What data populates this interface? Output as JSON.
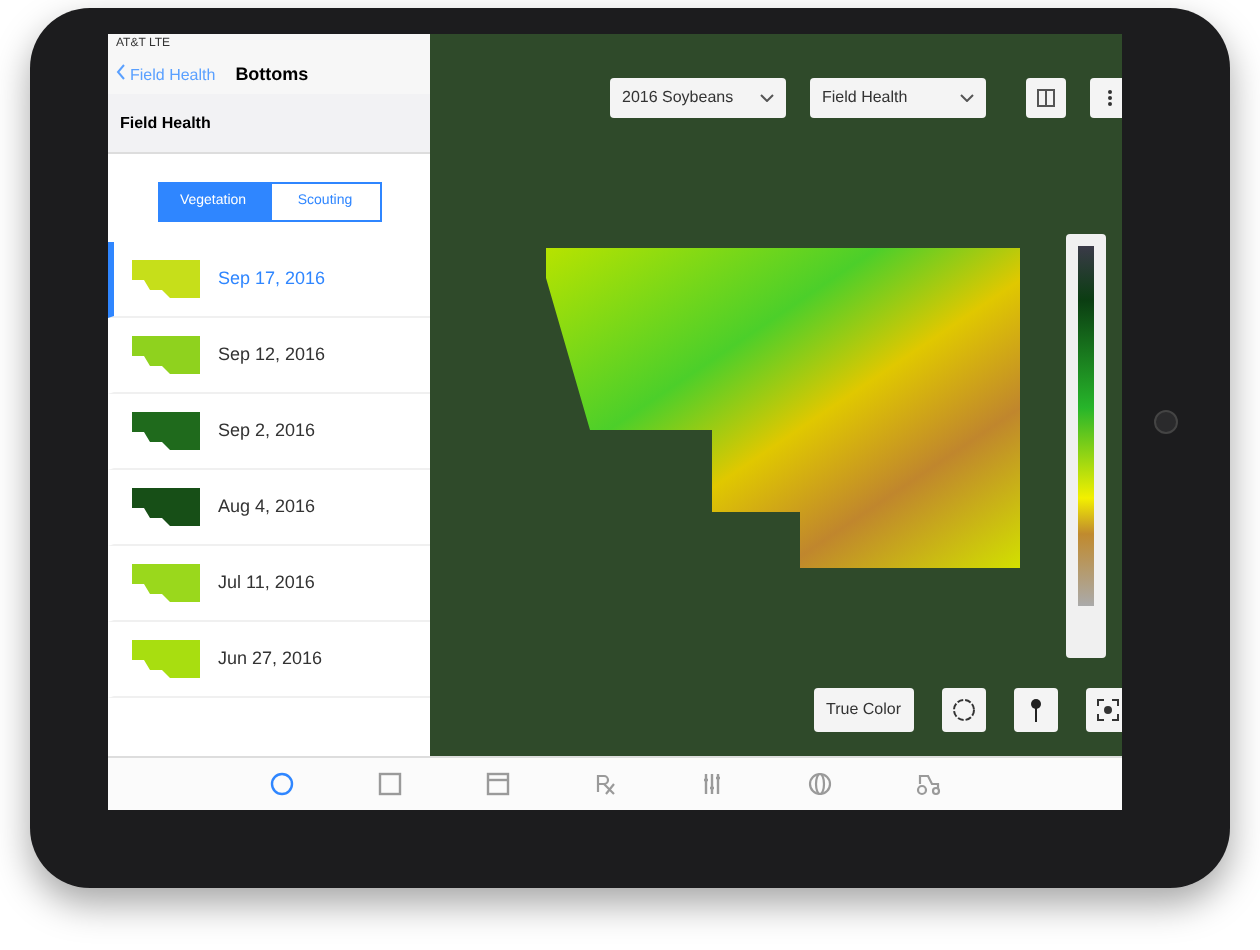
{
  "status_bar": {
    "carrier": "AT&T  LTE"
  },
  "nav": {
    "back": "Field Health",
    "title": "Bottoms"
  },
  "section_title": "Field Health",
  "segments": [
    {
      "label": "Vegetation",
      "selected": true
    },
    {
      "label": "Scouting",
      "selected": false
    }
  ],
  "images": [
    {
      "date": "Sep 17, 2016",
      "selected": true,
      "color": "#c6df1a"
    },
    {
      "date": "Sep 12, 2016",
      "selected": false,
      "color": "#8fd21e"
    },
    {
      "date": "Sep 2, 2016",
      "selected": false,
      "color": "#1f6a1c"
    },
    {
      "date": "Aug 4, 2016",
      "selected": false,
      "color": "#174f17"
    },
    {
      "date": "Jul 11, 2016",
      "selected": false,
      "color": "#9ad81c"
    },
    {
      "date": "Jun 27, 2016",
      "selected": false,
      "color": "#a8de10"
    }
  ],
  "map": {
    "season": "2016 Soybeans",
    "layer": "Field Health",
    "true_color": "True Color"
  },
  "tab_bar": [
    {
      "kind": "circle",
      "selected": true
    },
    {
      "kind": "square",
      "selected": false
    },
    {
      "kind": "calendar",
      "selected": false
    },
    {
      "kind": "rx",
      "selected": false
    },
    {
      "kind": "sliders",
      "selected": false
    },
    {
      "kind": "globe",
      "selected": false
    },
    {
      "kind": "tractor",
      "selected": false
    }
  ]
}
